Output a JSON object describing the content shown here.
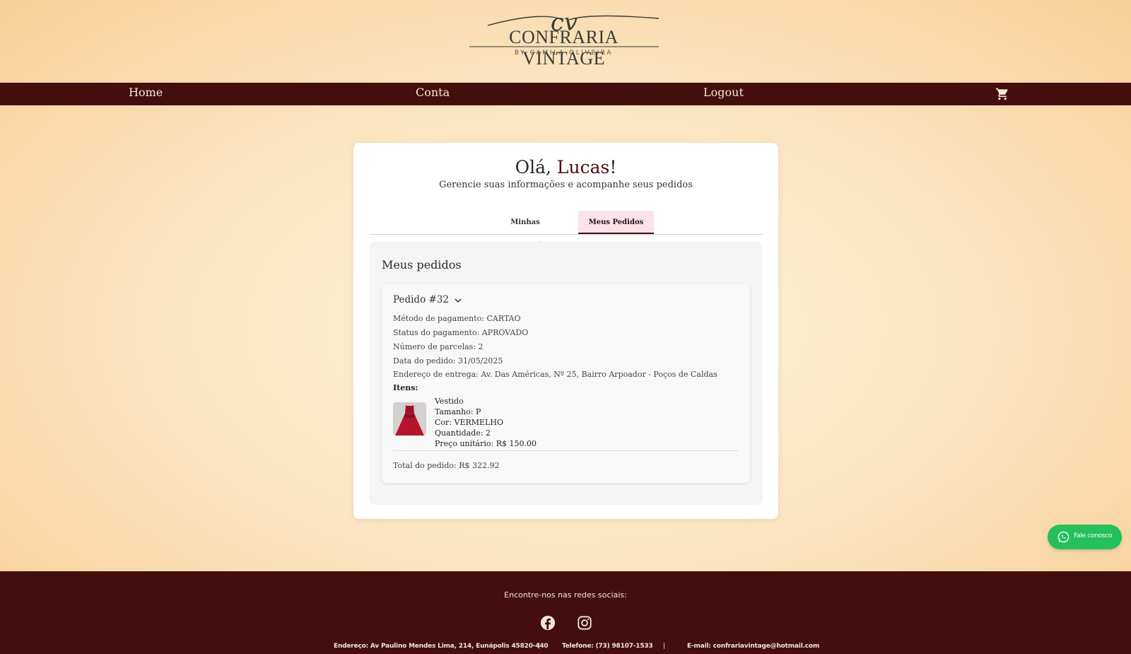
{
  "logo": {
    "main": "CONFRARIA VINTAGE",
    "script": "cv",
    "sub": "BY CAMILA OLIVEIRA"
  },
  "nav": {
    "home": "Home",
    "account": "Conta",
    "logout": "Logout",
    "cart_icon": "cart-icon"
  },
  "profile": {
    "greeting_prefix": "Olá, ",
    "user_name": "Lucas",
    "greeting_suffix": "!",
    "subtitle": "Gerencie suas informações e acompanhe seus pedidos"
  },
  "tabs": [
    {
      "label": "Minhas Informações",
      "active": false
    },
    {
      "label": "Meus Pedidos",
      "active": true
    }
  ],
  "orders": {
    "title": "Meus pedidos",
    "list": [
      {
        "header": "Pedido #32",
        "payment_method": "Método de pagamento: CARTAO",
        "payment_status": "Status do pagamento: APROVADO",
        "installments": "Número de parcelas: 2",
        "date": "Data do pedido: 31/05/2025",
        "address": "Endereço de entrega: Av. Das Américas, Nº 25, Bairro Arpoador - Poços de Caldas",
        "items_label": "Itens:",
        "items": [
          {
            "name": "Vestido",
            "size": "Tamanho: P",
            "color": "Cor: VERMELHO",
            "quantity": "Quantidade: 2",
            "unit_price": "Preço unitário: R$ 150.00"
          }
        ],
        "total": "Total do pedido: R$ 322.92"
      }
    ]
  },
  "whatsapp": {
    "label": "Fale conosco",
    "icon": "whatsapp-icon"
  },
  "footer": {
    "title": "Encontre-nos nas redes sociais:",
    "address": "Endereço: Av Paulino Mendes Lima, 214, Eunápolis 45820-440",
    "phone": "Telefone: (73) 98107-1533",
    "email": "E-mail: confrariavintage@hotmail.com",
    "separator": "|"
  },
  "colors": {
    "nav_bg": "#430e0c",
    "accent": "#4a0f0d",
    "tab_active_bg": "#fbe3ec",
    "whatsapp": "#25c05a"
  }
}
